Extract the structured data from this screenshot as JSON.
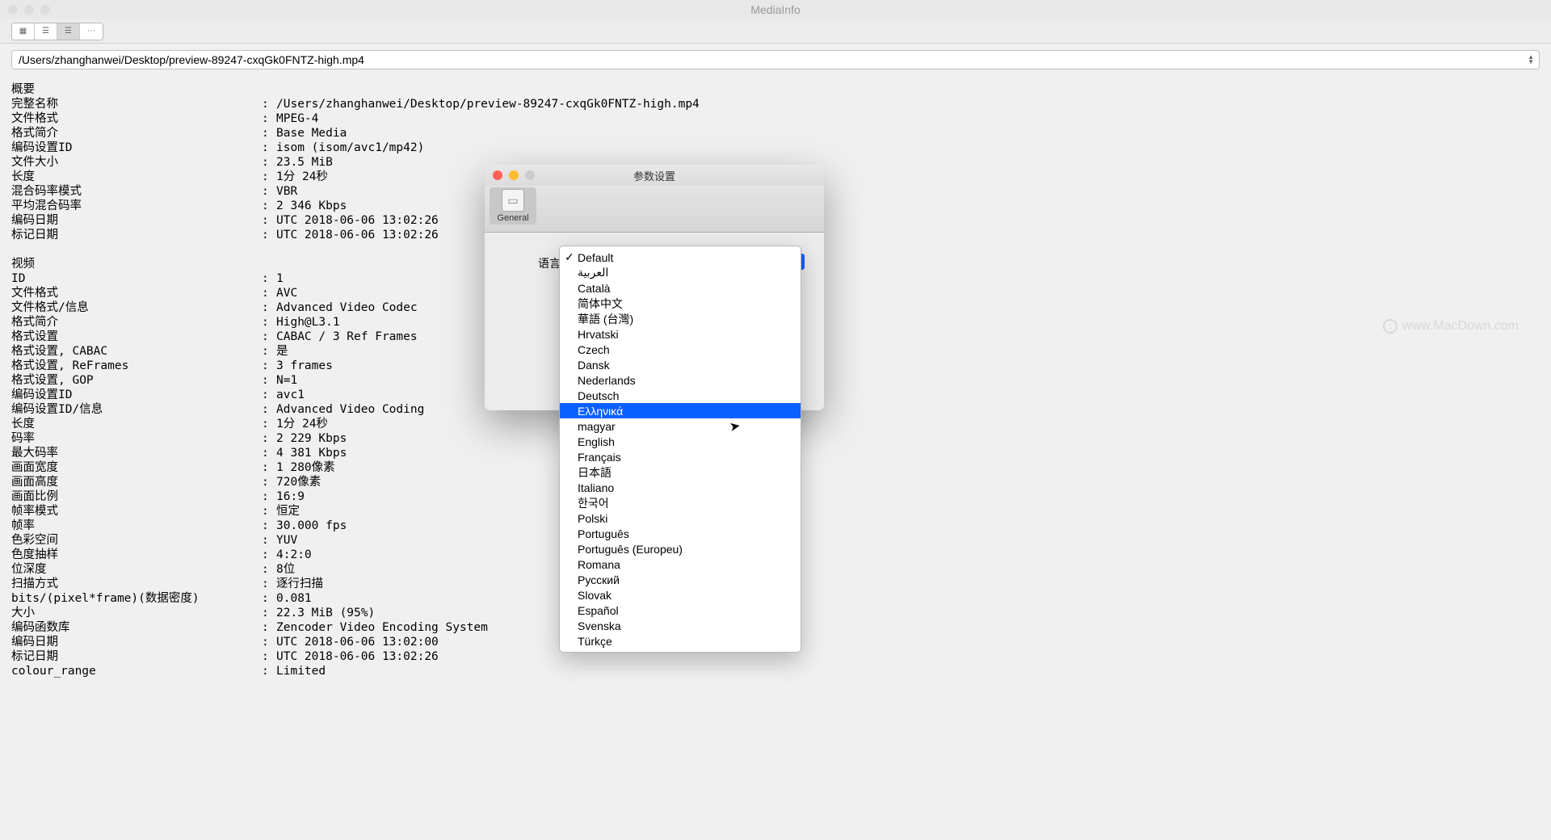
{
  "window": {
    "title": "MediaInfo"
  },
  "pathbar": {
    "path": "/Users/zhanghanwei/Desktop/preview-89247-cxqGk0FNTZ-high.mp4"
  },
  "watermark": {
    "text": "www.MacDown.com"
  },
  "sections": {
    "general": {
      "header": "概要",
      "rows": [
        {
          "label": "完整名称",
          "value": "/Users/zhanghanwei/Desktop/preview-89247-cxqGk0FNTZ-high.mp4"
        },
        {
          "label": "文件格式",
          "value": "MPEG-4"
        },
        {
          "label": "格式简介",
          "value": "Base Media"
        },
        {
          "label": "编码设置ID",
          "value": "isom (isom/avc1/mp42)"
        },
        {
          "label": "文件大小",
          "value": "23.5 MiB"
        },
        {
          "label": "长度",
          "value": "1分 24秒"
        },
        {
          "label": "混合码率模式",
          "value": "VBR"
        },
        {
          "label": "平均混合码率",
          "value": "2 346 Kbps"
        },
        {
          "label": "编码日期",
          "value": "UTC 2018-06-06 13:02:26"
        },
        {
          "label": "标记日期",
          "value": "UTC 2018-06-06 13:02:26"
        }
      ]
    },
    "video": {
      "header": "视频",
      "rows": [
        {
          "label": "ID",
          "value": "1"
        },
        {
          "label": "文件格式",
          "value": "AVC"
        },
        {
          "label": "文件格式/信息",
          "value": "Advanced Video Codec"
        },
        {
          "label": "格式简介",
          "value": "High@L3.1"
        },
        {
          "label": "格式设置",
          "value": "CABAC / 3 Ref Frames"
        },
        {
          "label": "格式设置, CABAC",
          "value": "是"
        },
        {
          "label": "格式设置, ReFrames",
          "value": "3 frames"
        },
        {
          "label": "格式设置, GOP",
          "value": "N=1"
        },
        {
          "label": "编码设置ID",
          "value": "avc1"
        },
        {
          "label": "编码设置ID/信息",
          "value": "Advanced Video Coding"
        },
        {
          "label": "长度",
          "value": "1分 24秒"
        },
        {
          "label": "码率",
          "value": "2 229 Kbps"
        },
        {
          "label": "最大码率",
          "value": "4 381 Kbps"
        },
        {
          "label": "画面宽度",
          "value": "1 280像素"
        },
        {
          "label": "画面高度",
          "value": "720像素"
        },
        {
          "label": "画面比例",
          "value": "16:9"
        },
        {
          "label": "帧率模式",
          "value": "恒定"
        },
        {
          "label": "帧率",
          "value": "30.000 fps"
        },
        {
          "label": "色彩空间",
          "value": "YUV"
        },
        {
          "label": "色度抽样",
          "value": "4:2:0"
        },
        {
          "label": "位深度",
          "value": "8位"
        },
        {
          "label": "扫描方式",
          "value": "逐行扫描"
        },
        {
          "label": "bits/(pixel*frame)(数据密度)",
          "value": "0.081"
        },
        {
          "label": "大小",
          "value": "22.3 MiB (95%)"
        },
        {
          "label": "编码函数库",
          "value": "Zencoder Video Encoding System"
        },
        {
          "label": "编码日期",
          "value": "UTC 2018-06-06 13:02:00"
        },
        {
          "label": "标记日期",
          "value": "UTC 2018-06-06 13:02:26"
        },
        {
          "label": "colour_range",
          "value": "Limited"
        }
      ]
    }
  },
  "prefs": {
    "title": "参数设置",
    "tab": "General",
    "lang_label": "语言"
  },
  "menu": {
    "items": [
      "Default",
      "العربية",
      "Català",
      "简体中文",
      "華語 (台灣)",
      "Hrvatski",
      "Czech",
      "Dansk",
      "Nederlands",
      "Deutsch",
      "Ελληνικά",
      "magyar",
      "English",
      "Français",
      "日本語",
      "Italiano",
      "한국어",
      "Polski",
      "Português",
      "Português (Europeu)",
      "Romana",
      "Русский",
      "Slovak",
      "Español",
      "Svenska",
      "Türkçe"
    ],
    "checked_index": 0,
    "selected_index": 10
  }
}
